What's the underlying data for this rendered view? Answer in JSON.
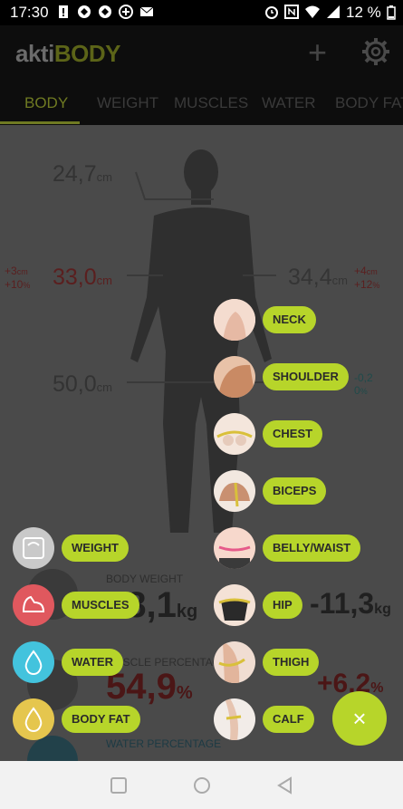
{
  "status": {
    "time": "17:30",
    "battery": "12 %"
  },
  "app": {
    "logo_a": "akti",
    "logo_b": "BODY"
  },
  "tabs": [
    "BODY",
    "WEIGHT",
    "MUSCLES",
    "WATER",
    "BODY FAT"
  ],
  "body": {
    "neck_value": "24,7",
    "unit": "cm",
    "left_arm": "33,0",
    "right_arm": "34,4",
    "left_change_cm": "+3",
    "left_change_pct": "+10",
    "right_change_cm": "+4",
    "right_change_pct": "+12",
    "waist_value": "50,0",
    "waist_change_cm": "-0,2",
    "waist_change_pct": "0",
    "cm": "cm",
    "pct": "%"
  },
  "stats": {
    "weight_label": "BODY WEIGHT",
    "weight_value": "58,1",
    "weight_unit": "kg",
    "weight_change": "-11,3",
    "weight_change_unit": "kg",
    "muscle_label": "MUSCLE PERCENTAGE",
    "muscle_value": "54,9",
    "muscle_unit": "%",
    "muscle_change": "+6,2",
    "muscle_change_unit": "%",
    "water_label": "WATER PERCENTAGE"
  },
  "menu_left": [
    "WEIGHT",
    "MUSCLES",
    "WATER",
    "BODY FAT"
  ],
  "menu_right": [
    "NECK",
    "SHOULDER",
    "CHEST",
    "BICEPS",
    "BELLY/WAIST",
    "HIP",
    "THIGH",
    "CALF"
  ],
  "colors": {
    "accent": "#b7d52a",
    "weight": "#c9c9c9",
    "muscles": "#e0585e",
    "water": "#43c3dd",
    "bodyfat": "#e5c64e"
  },
  "fab": {
    "icon": "close-icon",
    "symbol": "×"
  }
}
